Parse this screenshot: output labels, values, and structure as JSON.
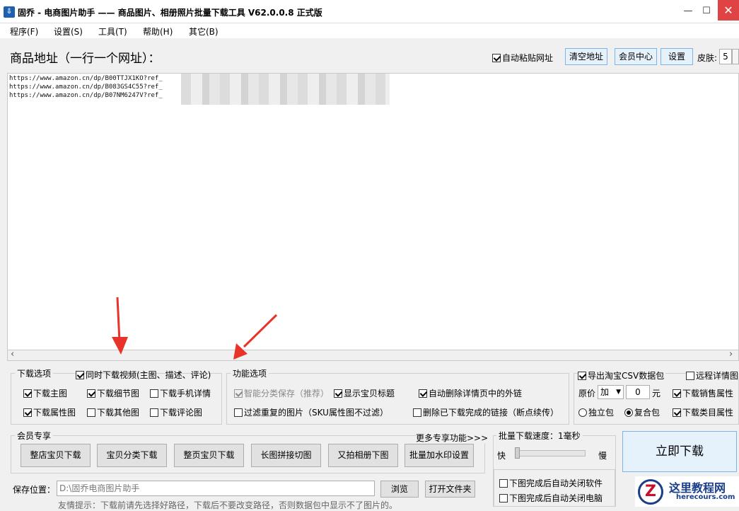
{
  "window": {
    "title": "固乔 - 电商图片助手 —— 商品图片、相册照片批量下载工具 V62.0.0.8 正式版",
    "minimize_glyph": "—",
    "maximize_glyph": "☐",
    "close_glyph": "✕"
  },
  "menu": [
    "程序(F)",
    "设置(S)",
    "工具(T)",
    "帮助(H)",
    "其它(B)"
  ],
  "header": {
    "label": "商品地址（一行一个网址）：",
    "auto_paste": "自动粘贴网址",
    "clear_btn": "清空地址",
    "member_btn": "会员中心",
    "settings_btn": "设置",
    "skin_label": "皮肤:",
    "skin_value": "5"
  },
  "urls": [
    "https://www.amazon.cn/dp/B00TTJX1KO?ref_",
    "https://www.amazon.cn/dp/B083GS4C55?ref_",
    "https://www.amazon.cn/dp/B07NM6247V?ref_"
  ],
  "scroll": {
    "left": "‹",
    "right": "›"
  },
  "download_options": {
    "title": "下载选项",
    "video": "同时下载视频(主图、描述、评论)",
    "main_img": "下载主图",
    "detail_img": "下载细节图",
    "mobile_detail": "下载手机详情",
    "attr_img": "下载属性图",
    "other_img": "下载其他图",
    "review_img": "下载评论图"
  },
  "function_options": {
    "title": "功能选项",
    "smart_save": "智能分类保存（推荐）",
    "show_title": "显示宝贝标题",
    "auto_remove_links": "自动删除详情页中的外链",
    "filter_dup": "过滤重复的图片（SKU属性图不过滤）",
    "delete_done": "删除已下载完成的链接（断点续传）"
  },
  "right_options": {
    "export_csv": "导出淘宝CSV数据包",
    "remote_detail": "远程详情图",
    "price_label": "原价",
    "price_op": "加",
    "price_value": "0",
    "yuan": "元",
    "sales_attr": "下载销售属性",
    "standalone": "独立包",
    "composite": "复合包",
    "category_attr": "下载类目属性"
  },
  "member": {
    "title": "会员专享",
    "more": "更多专享功能>>>",
    "buttons": [
      "整店宝贝下载",
      "宝贝分类下载",
      "整页宝贝下载",
      "长图拼接切图",
      "又拍相册下图",
      "批量加水印设置"
    ]
  },
  "speed": {
    "title": "批量下载速度：1毫秒",
    "fast": "快",
    "slow": "慢",
    "value_ms": 1,
    "close_app": "下图完成后自动关闭软件",
    "shutdown": "下图完成后自动关闭电脑"
  },
  "download_button": "立即下载",
  "save": {
    "label": "保存位置：",
    "path": "D:\\固乔电商图片助手",
    "browse": "浏览",
    "open_folder": "打开文件夹",
    "hint": "友情提示：下载前请先选择好路径，下载后不要改变路径，否则数据包中显示不了图片的。"
  },
  "logo": {
    "mark": "Z",
    "cn": "这里教程网",
    "en": "herecours.com"
  },
  "colors": {
    "arrow": "#e8332a",
    "title_bar": "#ffffff",
    "close": "#e04343",
    "accent_button": "#e5f1fb"
  }
}
